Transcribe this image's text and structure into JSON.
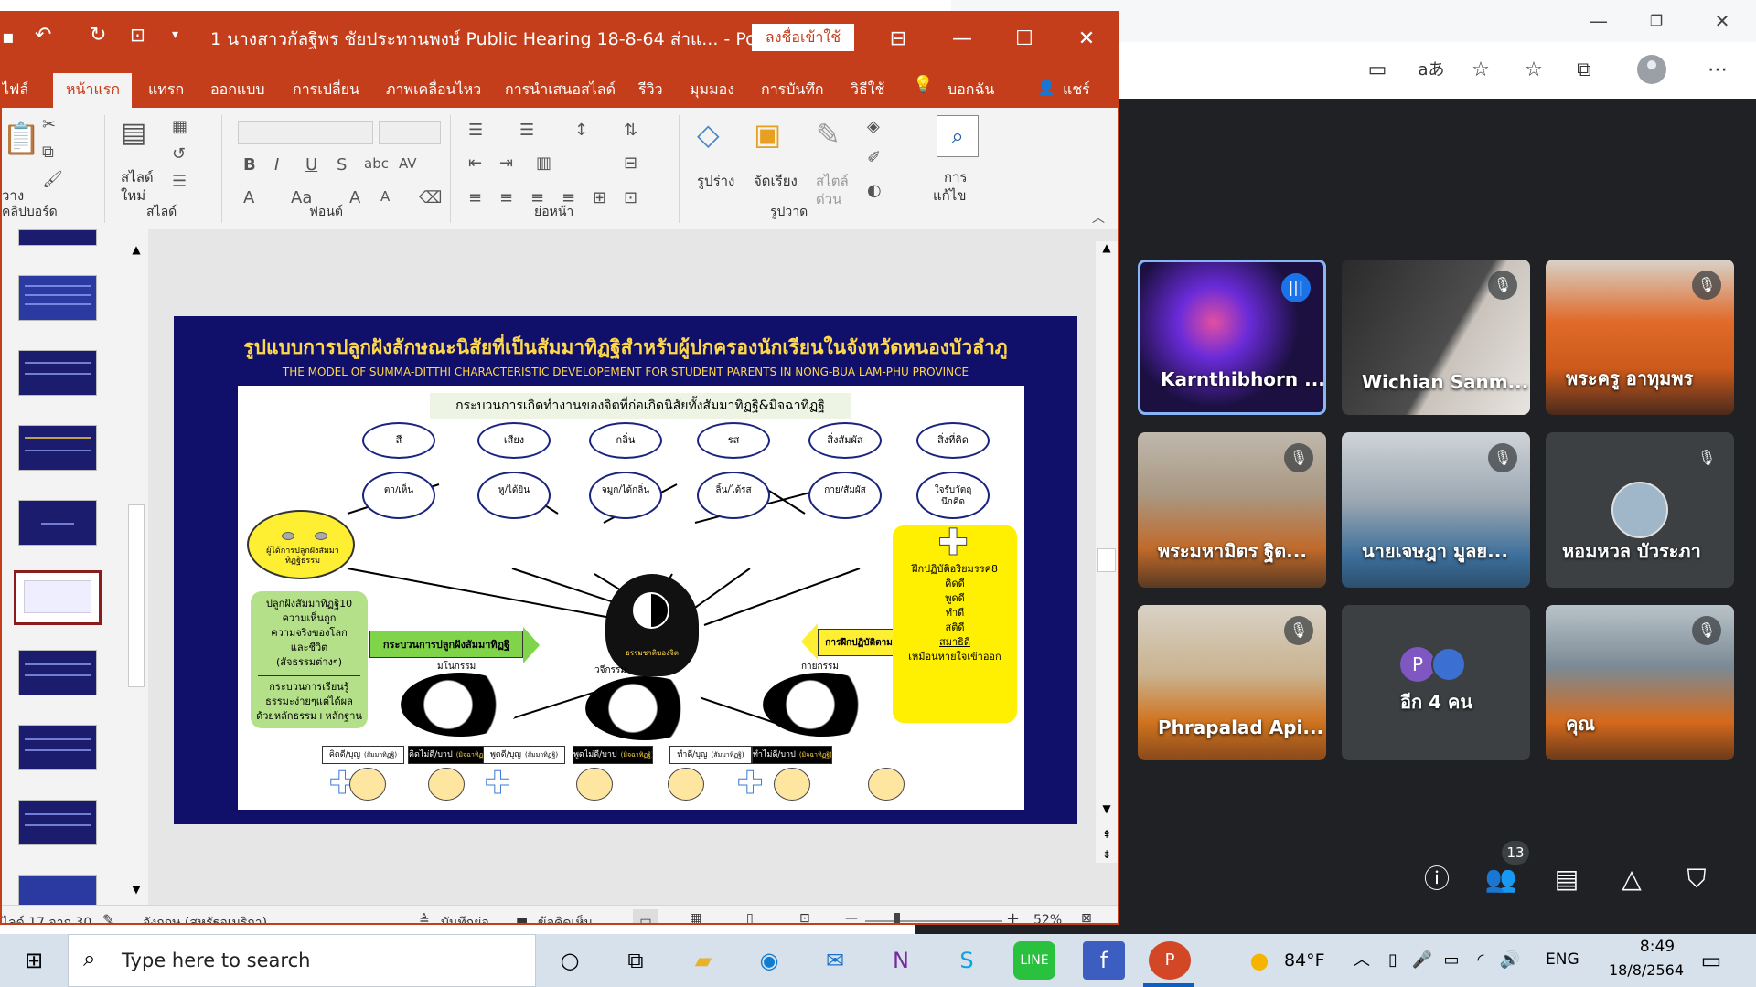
{
  "browser": {
    "toolbar_icons": [
      "camera-icon",
      "read-aloud-icon",
      "add-favorite-icon",
      "favorites-icon",
      "collections-icon",
      "profile-icon",
      "more-icon"
    ],
    "read_aloud_label": "aあ"
  },
  "meet": {
    "participants": [
      {
        "name": "Karnthibhorn ..."
      },
      {
        "name": "Wichian Sanm..."
      },
      {
        "name": "พระครู อาทุมพร"
      },
      {
        "name": "พระมหามิตร ฐิต..."
      },
      {
        "name": "นายเจษฎา มูลย..."
      },
      {
        "name": "หอมหวล บัวระภา"
      },
      {
        "name": "Phrapalad Api..."
      },
      {
        "name": "อีก 4 คน",
        "avatar_letter": "P"
      },
      {
        "name": "คุณ"
      }
    ],
    "participant_count": "13"
  },
  "ppt": {
    "title": "1 นางสาวกัลฐิพร ชัยประทานพงษ์  Public Hearing 18-8-64 ส่าแ...  -  PowerP...",
    "signin": "ลงชื่อเข้าใช้",
    "tabs": [
      "ไฟล์",
      "หน้าแรก",
      "แทรก",
      "ออกแบบ",
      "การเปลี่ยน",
      "ภาพเคลื่อนไหว",
      "การนำเสนอสไลด์",
      "รีวิว",
      "มุมมอง",
      "การบันทึก",
      "วิธีใช้",
      "บอกฉัน",
      "แชร์"
    ],
    "groups": {
      "clipboard": "คลิปบอร์ด",
      "slides": "สไลด์",
      "font": "ฟอนต์",
      "paragraph": "ย่อหน้า",
      "drawing": "รูปวาด"
    },
    "ribbon": {
      "paste_short": "วาง",
      "new_slide_1": "สไลด์",
      "new_slide_2": "ใหม่",
      "shape": "รูปร่าง",
      "arrange": "จัดเรียง",
      "style_1": "สไตล์",
      "style_2": "ด่วน",
      "edit_1": "การ",
      "edit_2": "แก้ไข"
    },
    "status": {
      "slide": "ไลด์ 17 จาก 30",
      "lang": "อังกฤษ (สหรัฐอเมริกา)",
      "notes": "บันทึกย่อ",
      "comments": "ข้อคิดเห็น",
      "zoom": "52%"
    }
  },
  "slide": {
    "title": "รูปแบบการปลูกฝังลักษณะนิสัยที่เป็นสัมมาทิฏฐิสำหรับผู้ปกครองนักเรียนในจังหวัดหนองบัวลำภู",
    "subtitle": "THE  MODEL OF SUMMA-DITTHI  CHARACTERISTIC DEVELOPEMENT FOR STUDENT PARENTS  IN NONG-BUA LAM-PHU PROVINCE",
    "heading": "กระบวนการเกิดทำงานของจิตที่ก่อเกิดนิสัยทั้งสัมมาทิฏฐิ&มิจฉาทิฏฐิ",
    "top_ovals": [
      "สี",
      "เสียง",
      "กลิ่น",
      "รส",
      "สิ่งสัมผัส",
      "สิ่งที่คิด"
    ],
    "mid_ovals": [
      "ตา/เห็น",
      "หู/ได้ยิน",
      "จมูก/ได้กลิ่น",
      "ลิ้น/ได้รส",
      "กาย/สัมผัส",
      "ใจรับวัตถุนึกคิด"
    ],
    "smiley": "ผู้ได้การปลูกฝังสัมมาทิฏฐิธรรม",
    "left_box": [
      "ปลูกฝังสัมมาทิฏฐิ10",
      "ความเห็นถูก",
      "ความจริงของโลก",
      "และชีวิต",
      "(สัจธรรมต่างๆ)",
      "กระบวนการเรียนรู้",
      "ธรรมะง่ายๆแต่ได้ผล",
      "ด้วยหลักธรรม+หลักฐาน"
    ],
    "left_arrow": "กระบวนการปลูกฝังสัมมาทิฏฐิ",
    "right_arrow": "การฝึกปฏิบัติตามอริยมรรคมีองค์ 8",
    "center": "ธรรมชาติของจิต",
    "right_box": [
      "ฝึกปฏิบัติอริยมรรค8",
      "คิดดี",
      "พูดดี",
      "ทำดี",
      "สติดี",
      "สมาธิดี",
      "เหมือนหายใจเข้าออก"
    ],
    "karma": [
      "มโนกรรม",
      "วจีกรรม",
      "กายกรรม"
    ],
    "bottom": [
      "คิดดี/บุญ",
      "(สัมมาทิฏฐิ)",
      "คิดไม่ดี/บาป",
      "(มิจฉาทิฏฐิ)",
      "พูดดี/บุญ",
      "(สัมมาทิฏฐิ)",
      "พูดไม่ดี/บาป",
      "(มิจฉาทิฏฐิ)",
      "ทำดี/บุญ",
      "(สัมมาทิฏฐิ)",
      "ทำไม่ดี/บาป",
      "(มิจฉาทิฏฐิ)"
    ]
  },
  "taskbar": {
    "search_placeholder": "Type here to search",
    "temp": "84°F",
    "lang": "ENG",
    "time": "8:49",
    "date": "18/8/2564"
  }
}
